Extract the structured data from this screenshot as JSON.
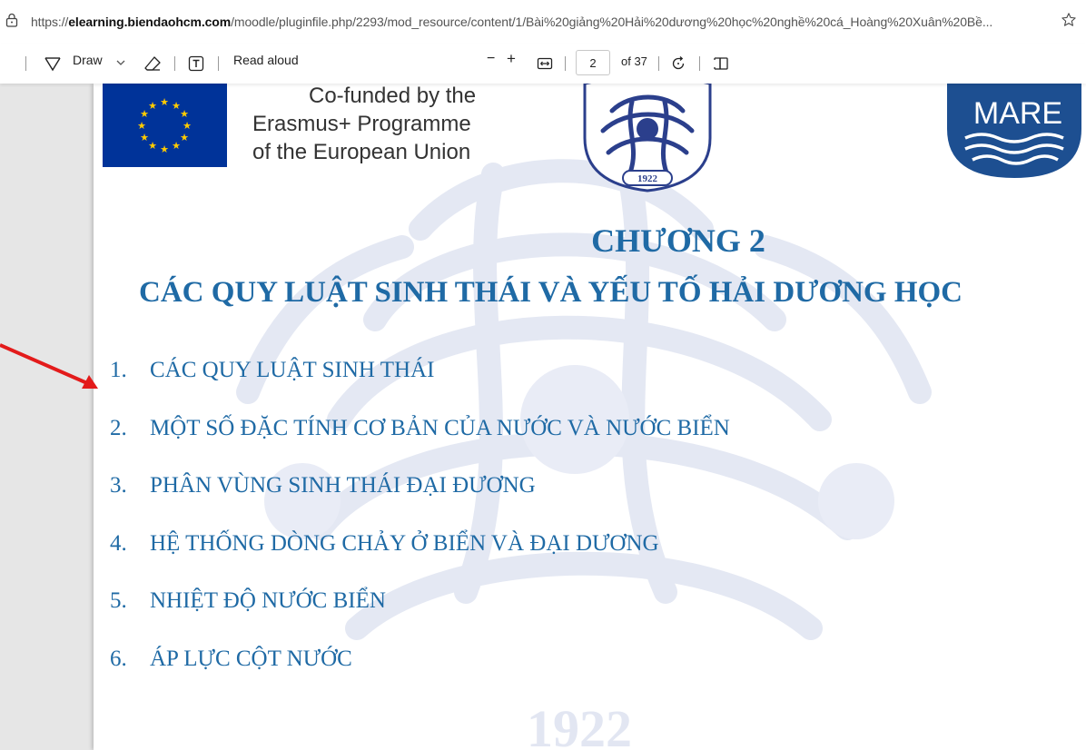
{
  "browser": {
    "url_prefix": "https://",
    "url_domain": "elearning.biendaohcm.com",
    "url_path": "/moodle/pluginfile.php/2293/mod_resource/content/1/Bài%20giảng%20Hải%20dương%20học%20nghề%20cá_Hoàng%20Xuân%20Bề..."
  },
  "toolbar": {
    "draw_label": "Draw",
    "read_aloud_label": "Read aloud",
    "zoom_out": "−",
    "zoom_in": "+",
    "page_current": "2",
    "page_total": "of 37"
  },
  "page": {
    "header": {
      "erasmus_line1": "Co-funded by the",
      "erasmus_line2": "Erasmus+ Programme",
      "erasmus_line3": "of the European Union",
      "center_logo_year": "1922",
      "mare_logo_text": "MARE"
    },
    "watermark_year": "1922",
    "chapter_title": "CHƯƠNG 2",
    "chapter_subtitle": "CÁC QUY LUẬT SINH THÁI VÀ YẾU TỐ HẢI DƯƠNG HỌC",
    "toc": [
      {
        "num": "1.",
        "text": "CÁC QUY LUẬT SINH THÁI"
      },
      {
        "num": "2.",
        "text": "MỘT SỐ ĐẶC TÍNH CƠ BẢN CỦA NƯỚC VÀ NƯỚC BIỂN"
      },
      {
        "num": "3.",
        "text": "PHÂN VÙNG SINH THÁI ĐẠI ĐƯƠNG"
      },
      {
        "num": "4.",
        "text": "HỆ THỐNG DÒNG CHẢY Ở BIỂN VÀ ĐẠI DƯƠNG"
      },
      {
        "num": "5.",
        "text": "NHIỆT ĐỘ NƯỚC BIỂN"
      },
      {
        "num": "6.",
        "text": "ÁP LỰC CỘT NƯỚC"
      }
    ]
  },
  "colors": {
    "heading_blue": "#1f6aa5",
    "eu_blue": "#003399",
    "mare_blue": "#1d4f91",
    "arrow_red": "#e31b1b"
  }
}
